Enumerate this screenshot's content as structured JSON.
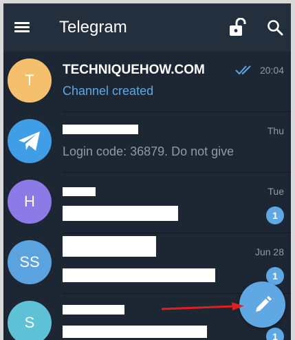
{
  "appbar": {
    "title": "Telegram",
    "icons": [
      "menu-icon",
      "lock-icon",
      "search-icon"
    ]
  },
  "chats": [
    {
      "avatar_letter": "T",
      "avatar_color": "#f4c06d",
      "name": "TECHNIQUEHOW.COM",
      "message": "Channel created",
      "time": "20:04",
      "status": "read"
    },
    {
      "avatar_letter": "",
      "avatar_color": "#3f9ee6",
      "name": "",
      "message": "Login code: 36879. Do not give thi…",
      "time": "Thu"
    },
    {
      "avatar_letter": "H",
      "avatar_color": "#8c7ae6",
      "name": "",
      "message": "",
      "time": "Tue",
      "unread": "1"
    },
    {
      "avatar_letter": "SS",
      "avatar_color": "#5aa3df",
      "name": "",
      "message": "",
      "time": "Jun 28",
      "unread": "1"
    },
    {
      "avatar_letter": "S",
      "avatar_color": "#5ec1d6",
      "name": "",
      "message": "",
      "time": "",
      "unread": "1"
    }
  ],
  "colors": {
    "background": "#1d2733",
    "appbar": "#242f3d",
    "accent": "#5fa8e4",
    "annotation_arrow": "#e02020"
  },
  "fab": {
    "icon": "pencil-icon"
  }
}
